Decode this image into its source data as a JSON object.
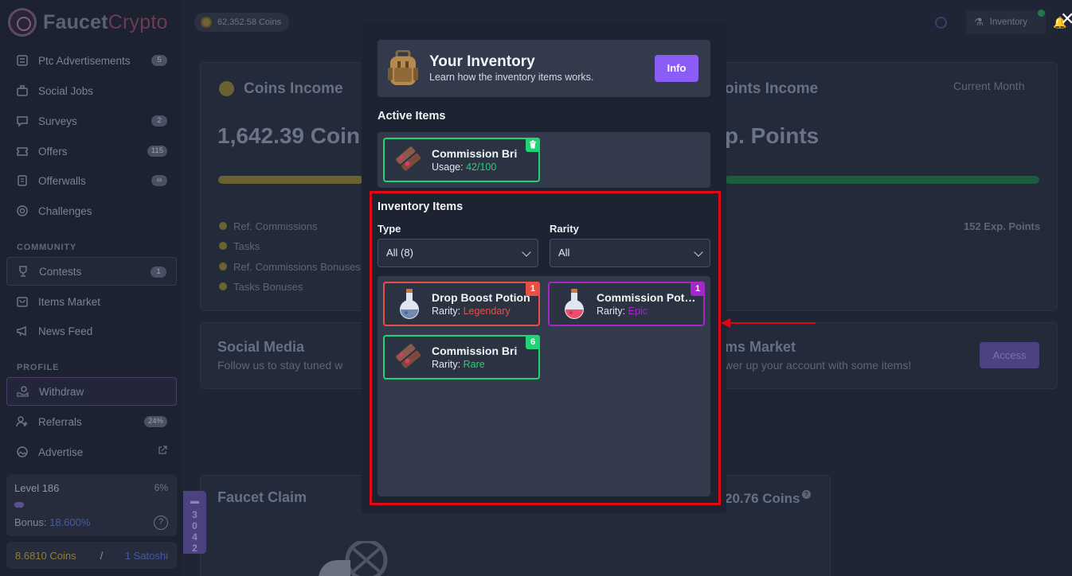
{
  "brand": {
    "name_a": "Faucet",
    "name_b": "Crypto"
  },
  "topbar": {
    "coins": "62,352.58 Coins",
    "inventory_label": "Inventory"
  },
  "sidebar": {
    "items": [
      {
        "label": "Ptc Advertisements",
        "count": "5",
        "icon": "list-icon"
      },
      {
        "label": "Social Jobs",
        "count": "",
        "icon": "briefcase-icon"
      },
      {
        "label": "Surveys",
        "count": "2",
        "icon": "chat-icon"
      },
      {
        "label": "Offers",
        "count": "115",
        "icon": "ticket-icon"
      },
      {
        "label": "Offerwalls",
        "count": "∞",
        "icon": "document-icon"
      },
      {
        "label": "Challenges",
        "count": "",
        "icon": "target-icon"
      }
    ],
    "community_heading": "COMMUNITY",
    "community": [
      {
        "label": "Contests",
        "count": "1",
        "icon": "trophy-icon"
      },
      {
        "label": "Items Market",
        "count": "",
        "icon": "shop-icon"
      },
      {
        "label": "News Feed",
        "count": "",
        "icon": "megaphone-icon"
      }
    ],
    "profile_heading": "PROFILE",
    "profile": [
      {
        "label": "Withdraw",
        "count": "",
        "icon": "hand-coin-icon"
      },
      {
        "label": "Referrals",
        "count": "24%",
        "icon": "users-icon"
      },
      {
        "label": "Advertise",
        "count": "",
        "icon": "image-icon"
      }
    ],
    "level": {
      "label": "Level 186",
      "percent": "6%",
      "progress": 0.06,
      "bonus_label": "Bonus:",
      "bonus_value": "18.600%"
    },
    "balance": {
      "coins": "8.6810 Coins",
      "sep": "/",
      "satoshi": "1 Satoshi"
    }
  },
  "background": {
    "coins_income_title": "Coins Income",
    "coins_income_value": "1,642.39 Coin",
    "points_income_title": "oints Income",
    "points_income_value": "p. Points",
    "current_month": "Current Month",
    "bullets": [
      "Ref. Commissions",
      "Tasks",
      "Ref. Commissions Bonuses",
      "Tasks Bonuses"
    ],
    "exp_points": "152 Exp. Points",
    "social_title": "Social Media",
    "social_sub": "Follow us to stay tuned w",
    "market_title": "ms Market",
    "market_sub": "wer up your account with some items!",
    "access_label": "Access",
    "faucet_title": "Faucet Claim",
    "faucet_value": "20.76 Coins",
    "side_tab": [
      "3",
      "0",
      "4",
      "2"
    ]
  },
  "modal": {
    "title": "Your Inventory",
    "subtitle": "Learn how the inventory items works.",
    "info_label": "Info",
    "active_title": "Active Items",
    "active_items": [
      {
        "name": "Commission Bri",
        "sub_label": "Usage:",
        "sub_value": "42/100",
        "color": "#1fd573"
      }
    ],
    "inventory_title": "Inventory Items",
    "type_label": "Type",
    "type_value": "All (8)",
    "rarity_label": "Rarity",
    "rarity_value": "All",
    "items": [
      {
        "name": "Drop Boost Potion",
        "rarity_label": "Rarity:",
        "rarity": "Legendary",
        "count": "1",
        "color": "#e85044",
        "icon": "potion-blue-icon"
      },
      {
        "name": "Commission Potion",
        "rarity_label": "Rarity:",
        "rarity": "Epic",
        "count": "1",
        "color": "#a327c9",
        "icon": "potion-pink-icon"
      },
      {
        "name": "Commission Bri",
        "rarity_label": "Rarity:",
        "rarity": "Rare",
        "count": "6",
        "color": "#1fd573",
        "icon": "bricks-icon"
      }
    ]
  },
  "colors": {
    "accent": "#8b5cf6",
    "highlight": "#e00613",
    "rare": "#1fd573",
    "legendary": "#e85044",
    "epic": "#a327c9"
  }
}
